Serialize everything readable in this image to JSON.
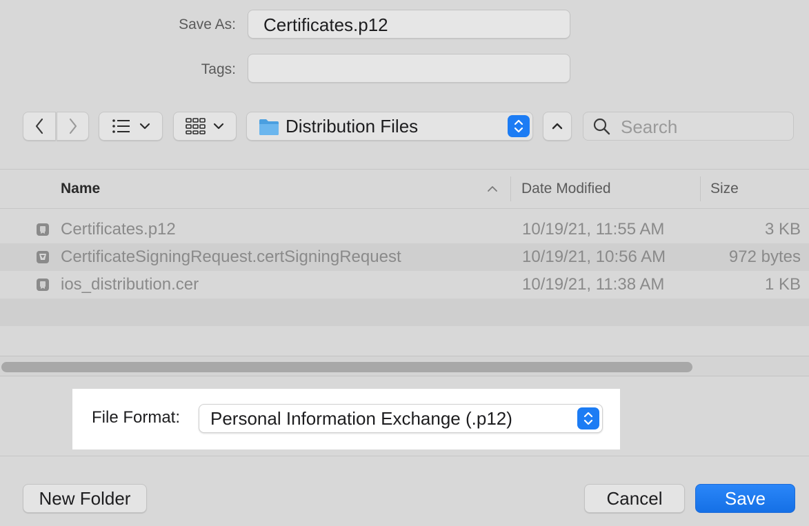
{
  "save_as": {
    "label": "Save As:",
    "value": "Certificates.p12"
  },
  "tags": {
    "label": "Tags:",
    "value": ""
  },
  "toolbar": {
    "location": "Distribution Files",
    "search_placeholder": "Search"
  },
  "columns": {
    "name": "Name",
    "date_modified": "Date Modified",
    "size": "Size"
  },
  "files": [
    {
      "name": "Certificates.p12",
      "date": "10/19/21, 11:55 AM",
      "size": "3 KB",
      "icon": "certificate-icon"
    },
    {
      "name": "CertificateSigningRequest.certSigningRequest",
      "date": "10/19/21, 10:56 AM",
      "size": "972 bytes",
      "icon": "signing-request-icon"
    },
    {
      "name": "ios_distribution.cer",
      "date": "10/19/21, 11:38 AM",
      "size": "1 KB",
      "icon": "certificate-icon"
    }
  ],
  "file_format": {
    "label": "File Format:",
    "value": "Personal Information Exchange (.p12)"
  },
  "buttons": {
    "new_folder": "New Folder",
    "cancel": "Cancel",
    "save": "Save"
  },
  "colors": {
    "accent": "#1c7cf4",
    "highlight": "#ffffff",
    "background": "#d8d8d8"
  }
}
